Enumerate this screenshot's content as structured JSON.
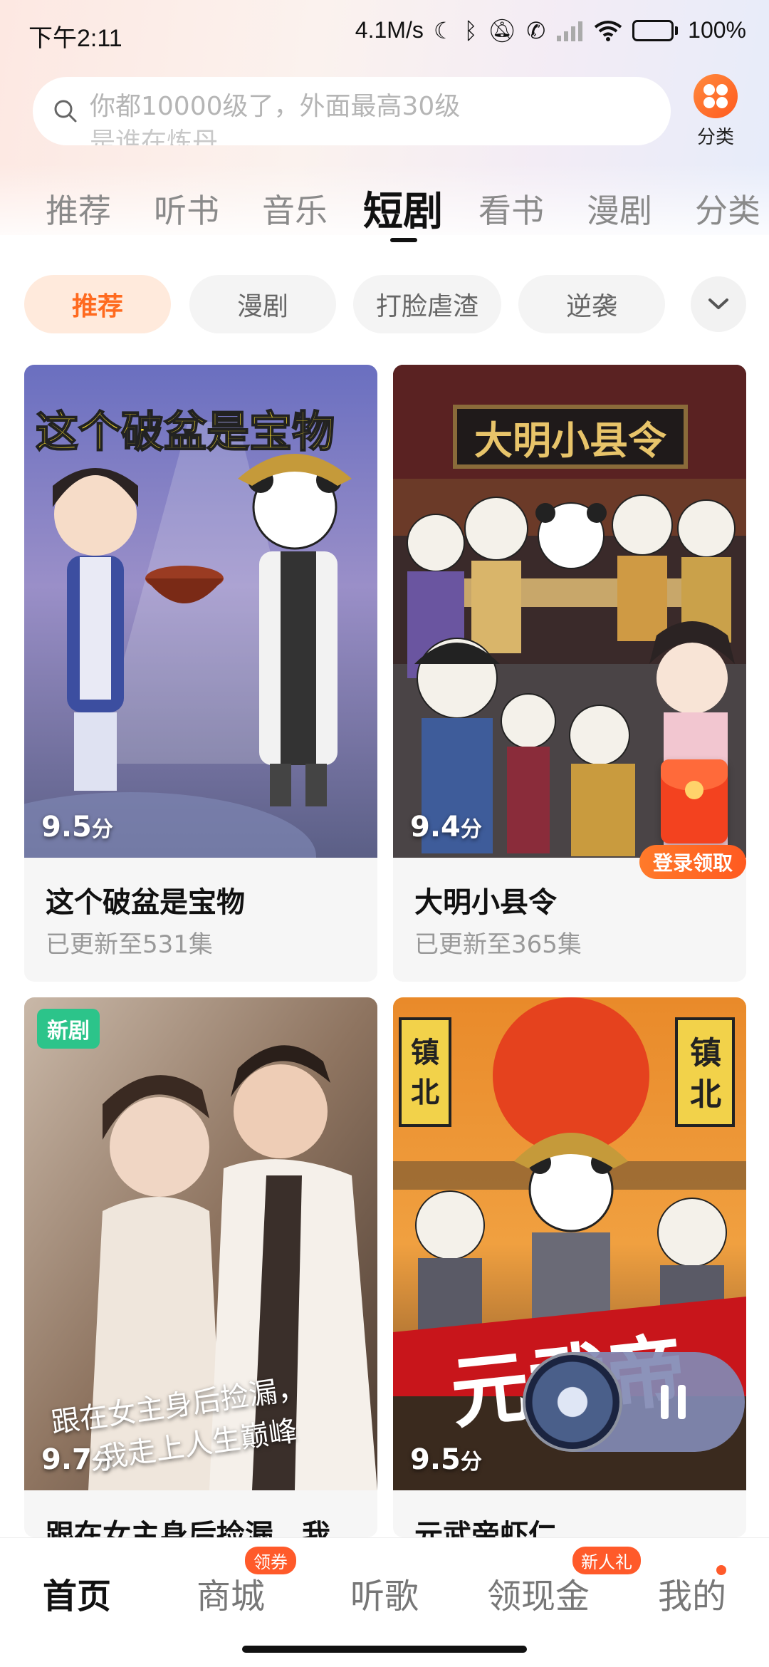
{
  "status_bar": {
    "time": "下午2:11",
    "net_speed": "4.1M/s",
    "battery_percent": "100%",
    "icons": [
      "moon-icon",
      "bluetooth-icon",
      "mute-icon",
      "call-icon",
      "signal-icon",
      "wifi-icon",
      "battery-icon"
    ]
  },
  "search": {
    "placeholder_line1": "你都10000级了，外面最高30级",
    "placeholder_line2": "是谁在炼丹",
    "category_label": "分类"
  },
  "main_tabs": [
    {
      "label": "推荐"
    },
    {
      "label": "听书"
    },
    {
      "label": "音乐"
    },
    {
      "label": "短剧",
      "active": true
    },
    {
      "label": "看书"
    },
    {
      "label": "漫剧"
    },
    {
      "label": "分类"
    }
  ],
  "filter_chips": [
    {
      "label": "推荐",
      "active": true
    },
    {
      "label": "漫剧"
    },
    {
      "label": "打脸虐渣"
    },
    {
      "label": "逆袭"
    }
  ],
  "dramas": [
    {
      "title": "这个破盆是宝物",
      "score": "9.5",
      "score_unit": "分",
      "episodes": "已更新至531集",
      "cover_text": "这个破盆是宝物"
    },
    {
      "title": "大明小县令",
      "score": "9.4",
      "score_unit": "分",
      "episodes": "已更新至365集",
      "cover_text": "大明小县令"
    },
    {
      "title": "跟在女主身后捡漏，我",
      "score": "9.7",
      "score_unit": "分",
      "badge": "新剧",
      "cover_text_1": "跟在女主身后捡漏，",
      "cover_text_2": "我走上人生巅峰"
    },
    {
      "title": "元武帝虾仁",
      "score": "9.5",
      "score_unit": "分",
      "cover_text": "元武帝",
      "banner_1": "镇",
      "banner_2": "北"
    }
  ],
  "promo": {
    "label": "登录领取"
  },
  "bottom_nav": [
    {
      "label": "首页",
      "active": true
    },
    {
      "label": "商城",
      "badge": "领券"
    },
    {
      "label": "听歌"
    },
    {
      "label": "领现金",
      "badge": "新人礼"
    },
    {
      "label": "我的",
      "dot": true
    }
  ],
  "colors": {
    "accent": "#ff6a1f",
    "new_badge": "#2cc48a",
    "nav_badge": "#ff5a2a"
  }
}
